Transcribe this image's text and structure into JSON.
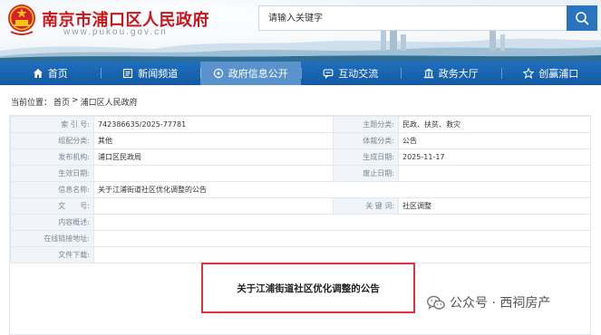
{
  "header": {
    "site_title": "南京市浦口区人民政府",
    "site_url": "www.pukou.gov.cn",
    "search": {
      "placeholder": "请输入关键字"
    }
  },
  "nav": {
    "items": [
      {
        "label": "首页",
        "icon": "home-icon",
        "active": false
      },
      {
        "label": "新闻频道",
        "icon": "news-icon",
        "active": false
      },
      {
        "label": "政府信息公开",
        "icon": "info-disclosure-icon",
        "active": true
      },
      {
        "label": "互动交流",
        "icon": "chat-icon",
        "active": false
      },
      {
        "label": "政务大厅",
        "icon": "hall-icon",
        "active": false
      },
      {
        "label": "创赢浦口",
        "icon": "star-icon",
        "active": false
      }
    ]
  },
  "breadcrumb": {
    "prefix": "当前位置：",
    "home": "首页",
    "separator": ">",
    "current": "浦口区人民政府"
  },
  "info": {
    "index_no": {
      "label": "索 引 号:",
      "value": "742386635/2025-77781"
    },
    "topic": {
      "label": "主题分类:",
      "value": "民政、扶贫、救灾"
    },
    "category": {
      "label": "组配分类:",
      "value": "其他"
    },
    "genre": {
      "label": "体裁分类:",
      "value": "公告"
    },
    "publisher": {
      "label": "发布机构:",
      "value": "浦口区民政局"
    },
    "created": {
      "label": "生成日期:",
      "value": "2025-11-17"
    },
    "effective": {
      "label": "生效日期:",
      "value": ""
    },
    "abolished": {
      "label": "废止日期:",
      "value": ""
    },
    "title": {
      "label": "信息名称:",
      "value": "关于江浦街道社区优化调整的公告"
    },
    "doc_no": {
      "label": "文　　号:",
      "value": ""
    },
    "keywords": {
      "label": "关 键 词:",
      "value": "社区调整"
    },
    "summary": {
      "label": "内容概述:",
      "value": ""
    },
    "online_link": {
      "label": "在线链接地址:",
      "value": ""
    },
    "download": {
      "label": "文件下载:",
      "value": ""
    }
  },
  "document": {
    "heading": "关于江浦街道社区优化调整的公告"
  },
  "watermark": {
    "text": "公众号 · 西祠房产"
  },
  "colors": {
    "brand_red": "#c8161d",
    "nav_blue": "#135aa3",
    "nav_active": "#5a92cb",
    "highlight_border": "#d9363e"
  }
}
